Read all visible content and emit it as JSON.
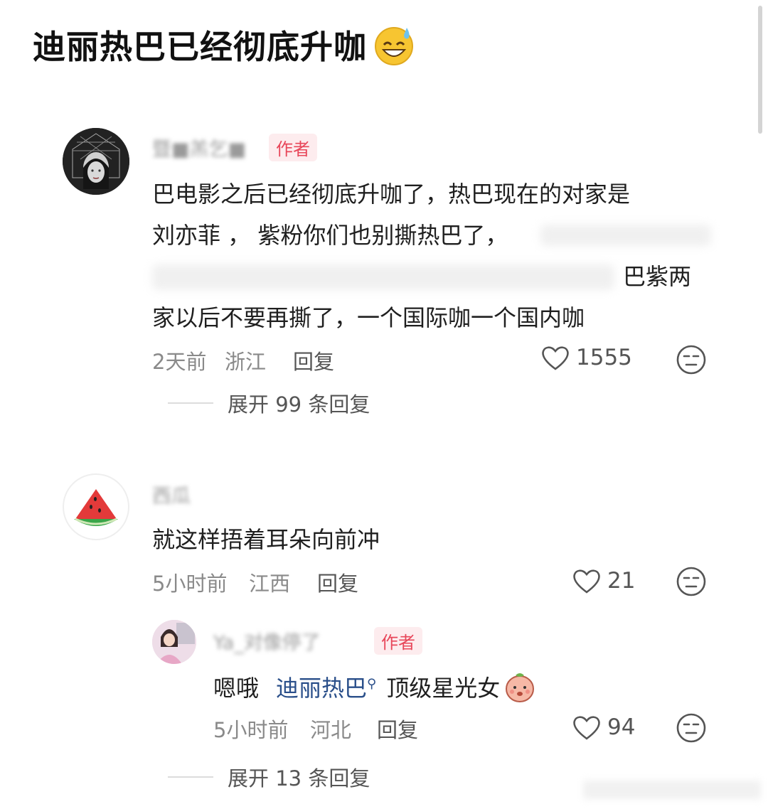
{
  "post": {
    "title": "迪丽热巴已经彻底升咖",
    "title_emoji": "sweat-smile-emoji"
  },
  "comments": [
    {
      "username": "暨■羔乞■",
      "badge": "作者",
      "lines": [
        "巴电影之后已经彻底升咖了，热巴现在的对家是",
        "刘亦菲 ， 紫粉你们也别撕热巴了，",
        "巴紫两",
        "家以后不要再撕了，一个国际咖一个国内咖"
      ],
      "time": "2天前",
      "location": "浙江",
      "reply_label": "回复",
      "likes": "1555",
      "expand": "展开 99 条回复"
    },
    {
      "username": "西瓜",
      "text": "就这样捂着耳朵向前冲",
      "time": "5小时前",
      "location": "江西",
      "reply_label": "回复",
      "likes": "21",
      "reply": {
        "username": "Ya_对像停了",
        "badge": "作者",
        "prefix": "嗯哦",
        "mention": "迪丽热巴",
        "suffix": "顶级星光女",
        "time": "5小时前",
        "location": "河北",
        "reply_label": "回复",
        "likes": "94"
      },
      "expand": "展开 13 条回复"
    }
  ],
  "icons": {
    "like": "heart-outline-icon",
    "neutral": "neutral-face-icon",
    "mention_search": "search-icon",
    "peach_emoji": "peach-emoji"
  },
  "colors": {
    "author_badge_text": "#e8475a",
    "author_badge_bg": "#fdecee",
    "mention": "#2a4f8a",
    "meta_gray": "#8a8a8a"
  }
}
